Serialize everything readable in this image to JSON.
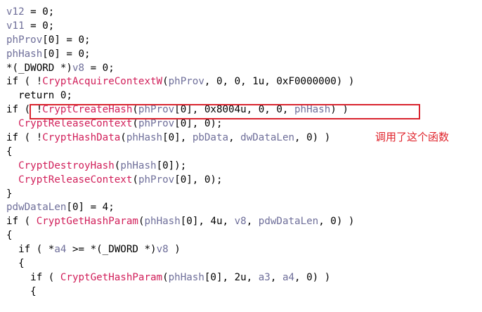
{
  "code": {
    "lines": [
      [
        {
          "t": "v12",
          "c": "var"
        },
        {
          "t": " = 0;",
          "c": "op"
        }
      ],
      [
        {
          "t": "v11",
          "c": "var"
        },
        {
          "t": " = 0;",
          "c": "op"
        }
      ],
      [
        {
          "t": "phProv",
          "c": "var"
        },
        {
          "t": "[0] = 0;",
          "c": "op"
        }
      ],
      [
        {
          "t": "phHash",
          "c": "var"
        },
        {
          "t": "[0] = 0;",
          "c": "op"
        }
      ],
      [
        {
          "t": "*(_DWORD *)",
          "c": "op"
        },
        {
          "t": "v8",
          "c": "var"
        },
        {
          "t": " = 0;",
          "c": "op"
        }
      ],
      [
        {
          "t": "if ( !",
          "c": "kw"
        },
        {
          "t": "CryptAcquireContextW",
          "c": "api"
        },
        {
          "t": "(",
          "c": "op"
        },
        {
          "t": "phProv",
          "c": "var"
        },
        {
          "t": ", 0, 0, 1u, 0xF0000000) )",
          "c": "op"
        }
      ],
      [
        {
          "t": "  return 0;",
          "c": "kw"
        }
      ],
      [
        {
          "t": "if ( !",
          "c": "kw"
        },
        {
          "t": "CryptCreateHash",
          "c": "api"
        },
        {
          "t": "(",
          "c": "op"
        },
        {
          "t": "phProv",
          "c": "var"
        },
        {
          "t": "[0], 0x8004u, 0, 0, ",
          "c": "op"
        },
        {
          "t": "phHash",
          "c": "var"
        },
        {
          "t": ") )",
          "c": "op"
        }
      ],
      [
        {
          "t": "  ",
          "c": "op"
        },
        {
          "t": "CryptReleaseContext",
          "c": "api"
        },
        {
          "t": "(",
          "c": "op"
        },
        {
          "t": "phProv",
          "c": "var"
        },
        {
          "t": "[0], 0);",
          "c": "op"
        }
      ],
      [
        {
          "t": "if ( !",
          "c": "kw"
        },
        {
          "t": "CryptHashData",
          "c": "api"
        },
        {
          "t": "(",
          "c": "op"
        },
        {
          "t": "phHash",
          "c": "var"
        },
        {
          "t": "[0], ",
          "c": "op"
        },
        {
          "t": "pbData",
          "c": "var"
        },
        {
          "t": ", ",
          "c": "op"
        },
        {
          "t": "dwDataLen",
          "c": "var"
        },
        {
          "t": ", 0) )",
          "c": "op"
        }
      ],
      [
        {
          "t": "{",
          "c": "op"
        }
      ],
      [
        {
          "t": "  ",
          "c": "op"
        },
        {
          "t": "CryptDestroyHash",
          "c": "api"
        },
        {
          "t": "(",
          "c": "op"
        },
        {
          "t": "phHash",
          "c": "var"
        },
        {
          "t": "[0]);",
          "c": "op"
        }
      ],
      [
        {
          "t": "  ",
          "c": "op"
        },
        {
          "t": "CryptReleaseContext",
          "c": "api"
        },
        {
          "t": "(",
          "c": "op"
        },
        {
          "t": "phProv",
          "c": "var"
        },
        {
          "t": "[0], 0);",
          "c": "op"
        }
      ],
      [
        {
          "t": "}",
          "c": "op"
        }
      ],
      [
        {
          "t": "pdwDataLen",
          "c": "var"
        },
        {
          "t": "[0] = 4;",
          "c": "op"
        }
      ],
      [
        {
          "t": "if ( ",
          "c": "kw"
        },
        {
          "t": "CryptGetHashParam",
          "c": "api"
        },
        {
          "t": "(",
          "c": "op"
        },
        {
          "t": "phHash",
          "c": "var"
        },
        {
          "t": "[0], 4u, ",
          "c": "op"
        },
        {
          "t": "v8",
          "c": "var"
        },
        {
          "t": ", ",
          "c": "op"
        },
        {
          "t": "pdwDataLen",
          "c": "var"
        },
        {
          "t": ", 0) )",
          "c": "op"
        }
      ],
      [
        {
          "t": "{",
          "c": "op"
        }
      ],
      [
        {
          "t": "  if ( *",
          "c": "kw"
        },
        {
          "t": "a4",
          "c": "var"
        },
        {
          "t": " >= *(_DWORD *)",
          "c": "op"
        },
        {
          "t": "v8",
          "c": "var"
        },
        {
          "t": " )",
          "c": "op"
        }
      ],
      [
        {
          "t": "  {",
          "c": "op"
        }
      ],
      [
        {
          "t": "    if ( ",
          "c": "kw"
        },
        {
          "t": "CryptGetHashParam",
          "c": "api"
        },
        {
          "t": "(",
          "c": "op"
        },
        {
          "t": "phHash",
          "c": "var"
        },
        {
          "t": "[0], 2u, ",
          "c": "op"
        },
        {
          "t": "a3",
          "c": "var"
        },
        {
          "t": ", ",
          "c": "op"
        },
        {
          "t": "a4",
          "c": "var"
        },
        {
          "t": ", 0) )",
          "c": "op"
        }
      ],
      [
        {
          "t": "    {",
          "c": "op"
        }
      ]
    ]
  },
  "annotation": {
    "text": "调用了这个函数"
  },
  "colors": {
    "api": "#d11f5a",
    "variable": "#6f6f9a",
    "plain": "#000000",
    "highlight_border": "#d9232e",
    "annotation_text": "#e0242c"
  }
}
